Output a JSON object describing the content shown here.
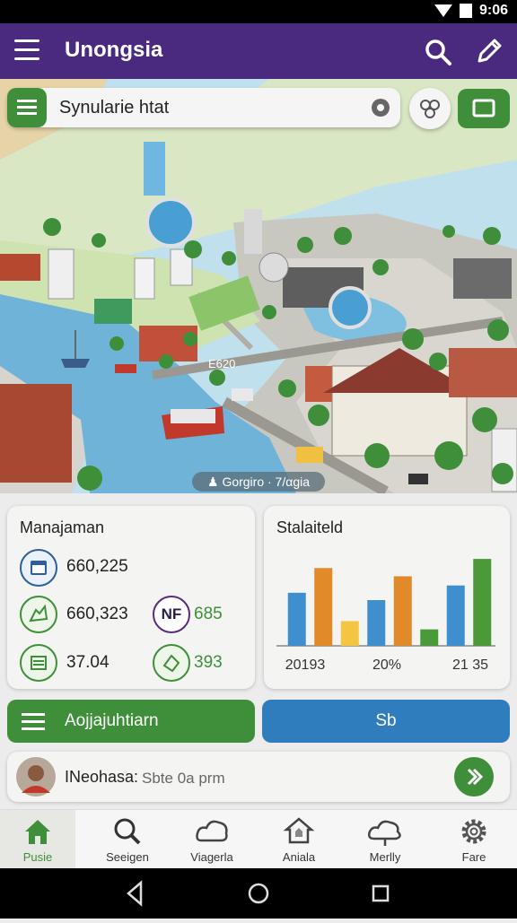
{
  "status": {
    "time": "9:06"
  },
  "app": {
    "title": "Unongsia"
  },
  "search": {
    "value": "Synularie htat"
  },
  "map": {
    "caption": "Gorgiro · 7/αgia",
    "label": "E620"
  },
  "management": {
    "title": "Manajaman",
    "stats": [
      {
        "icon": "calendar-icon",
        "value": "660,225"
      },
      {
        "icon": "hands-icon",
        "value": "660,323"
      },
      {
        "icon": "nf-badge-icon",
        "label": "NF",
        "value": "685"
      },
      {
        "icon": "document-icon",
        "value": "37.04"
      },
      {
        "icon": "hand-card-icon",
        "value": "393"
      }
    ]
  },
  "chart_data": {
    "type": "bar",
    "title": "Stalaiteld",
    "tick_labels": [
      "20193",
      "20%",
      "21 35"
    ],
    "values": [
      58,
      85,
      27,
      50,
      76,
      18,
      66,
      95
    ],
    "colors": [
      "#3f8fcf",
      "#e08a2a",
      "#f4c542",
      "#3f8fcf",
      "#e08a2a",
      "#4a9a3a",
      "#3f8fcf",
      "#4a9a3a"
    ],
    "ylim": [
      0,
      100
    ]
  },
  "actions": {
    "primary_label": "Aojjajuhtiarn",
    "secondary_label": "Sb"
  },
  "user": {
    "name": "INeohasa:",
    "status": "Sbte 0a prm"
  },
  "nav": [
    {
      "label": "Pusie",
      "icon": "home-icon",
      "active": true
    },
    {
      "label": "Seeigen",
      "icon": "search-icon",
      "active": false
    },
    {
      "label": "Viagerla",
      "icon": "cloud-cluster-icon",
      "active": false
    },
    {
      "label": "Aniala",
      "icon": "house-shield-icon",
      "active": false
    },
    {
      "label": "Merlly",
      "icon": "cloud-icon",
      "active": false
    },
    {
      "label": "Fare",
      "icon": "gear-icon",
      "active": false
    }
  ],
  "colors": {
    "appbar": "#4a2a7e",
    "accent_green": "#3f8f3a",
    "accent_blue": "#2f7dbd"
  }
}
